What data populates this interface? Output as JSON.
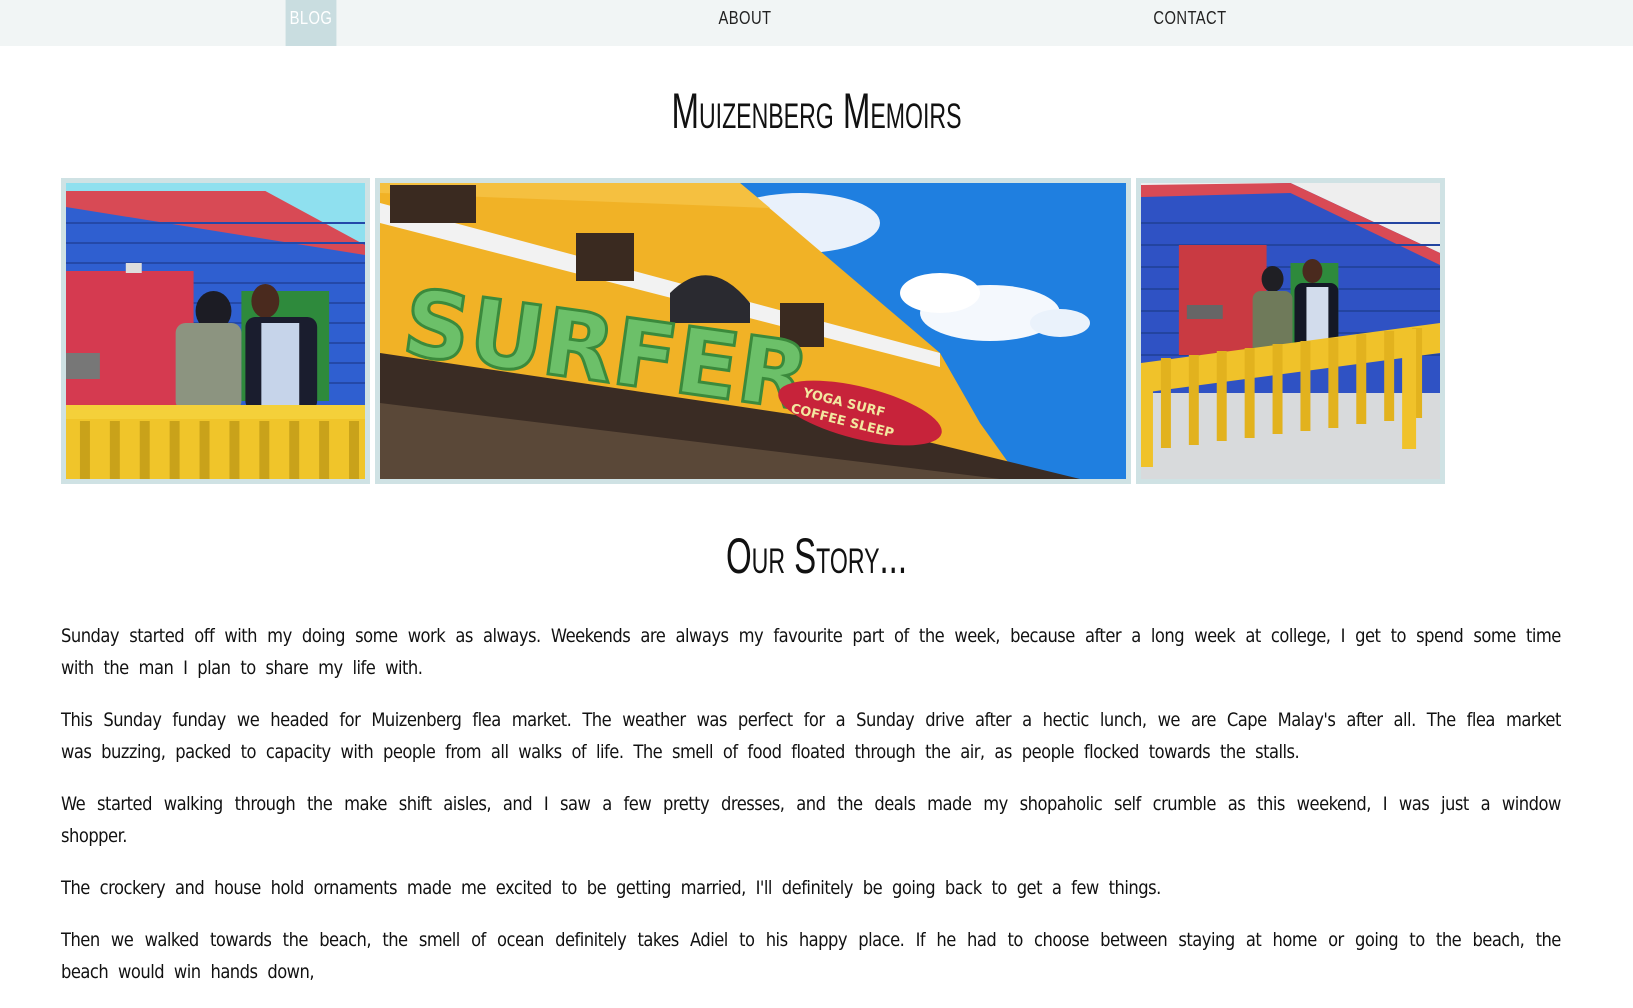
{
  "nav": {
    "items": [
      {
        "label": "BLOG",
        "active": true
      },
      {
        "label": "ABOUT",
        "active": false
      },
      {
        "label": "CONTACT",
        "active": false
      }
    ]
  },
  "page": {
    "title": "Muizenberg Memoirs",
    "subtitle": "Our Story..."
  },
  "gallery": {
    "photos": [
      {
        "sign_text": ""
      },
      {
        "sign_text": "SURFER",
        "sub_sign": "YOGA SURF COFFEE SLEEP"
      },
      {
        "sign_text": ""
      }
    ]
  },
  "story": {
    "paragraphs": [
      "Sunday started off with my doing some work as always. Weekends are always my favourite part of the week, because after a long week at college, I get to spend some time with the man I plan to share my life with.",
      "This Sunday funday we headed for Muizenberg flea market. The weather was perfect for a Sunday drive after a hectic lunch, we are Cape Malay's after all. The flea market was buzzing, packed to capacity with people from all walks of life. The smell of food floated through the air, as people flocked towards the stalls.",
      "We started walking through the make shift aisles, and I saw a few pretty dresses, and the deals made my shopaholic self crumble as this weekend, I was just a window shopper.",
      "The crockery and house hold ornaments made me excited to be getting married, I'll definitely be going back to get a few things.",
      "Then we walked towards the beach, the smell of ocean definitely takes Adiel to his happy place. If he had to choose between staying at home or going to the beach, the beach would win hands down,"
    ]
  },
  "colors": {
    "nav_bg": "#f1f5f5",
    "nav_active_bg": "#c9dde0",
    "photo_border": "#cfe2e4"
  }
}
